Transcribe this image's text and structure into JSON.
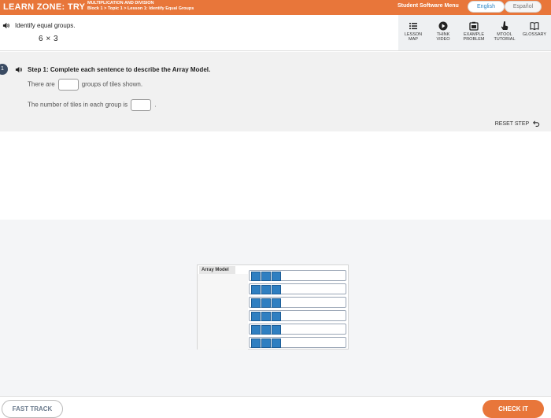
{
  "header": {
    "brand": "LEARN ZONE: TRY",
    "module": "MULTIPLICATION AND DIVISION",
    "breadcrumb": "Block 1 > Topic 1 > Lesson 1: Identify Equal Groups",
    "menu_label": "Student Software Menu",
    "languages": [
      "English",
      "Español"
    ],
    "selected_language": "English",
    "colors": {
      "brand_orange": "#e8763a",
      "link_blue": "#2d86c5"
    }
  },
  "question": {
    "prompt": "Identify equal groups.",
    "expression": "6 × 3"
  },
  "tools": [
    {
      "line1": "LESSON",
      "line2": "MAP",
      "icon": "list-icon"
    },
    {
      "line1": "THINK",
      "line2": "VIDEO",
      "icon": "play-icon"
    },
    {
      "line1": "EXAMPLE",
      "line2": "PROBLEM",
      "icon": "board-icon"
    },
    {
      "line1": "MTOOL",
      "line2": "TUTORIAL",
      "icon": "pointer-icon"
    },
    {
      "line1": "GLOSSARY",
      "line2": "",
      "icon": "book-icon"
    }
  ],
  "step": {
    "number": "1",
    "title": "Step 1: Complete each sentence to describe the Array Model.",
    "sentence1_pre": "There are",
    "sentence1_post": "groups of tiles shown.",
    "sentence2_pre": "The number of tiles in each group is",
    "sentence2_post": ".",
    "reset_label": "RESET STEP"
  },
  "array_model": {
    "label": "Array Model",
    "groups": 6,
    "tiles_per_group": 3,
    "tile_color": "#2f7fc1"
  },
  "footer": {
    "fast_track": "FAST TRACK",
    "check": "CHECK IT"
  }
}
